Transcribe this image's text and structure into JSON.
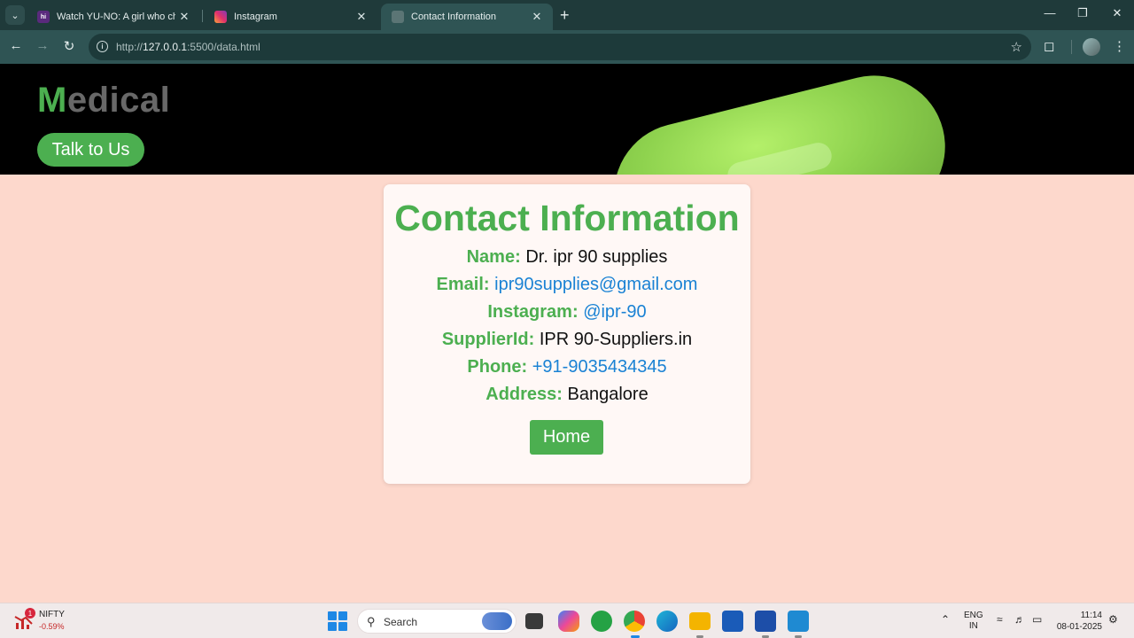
{
  "browser": {
    "tabs": [
      {
        "title": "Watch YU-NO: A girl who chant",
        "favicon": "hi",
        "active": false
      },
      {
        "title": "Instagram",
        "favicon": "",
        "active": false
      },
      {
        "title": "Contact Information",
        "favicon": "",
        "active": true
      }
    ],
    "url": {
      "prefix": "http://",
      "host": "127.0.0.1",
      "rest": ":5500/data.html"
    }
  },
  "page": {
    "logo_first": "M",
    "logo_rest": "edical",
    "talk_button": "Talk to Us",
    "card": {
      "title": "Contact Information",
      "rows": [
        {
          "label": "Name:",
          "value": "Dr. ipr 90 supplies",
          "link": false
        },
        {
          "label": "Email:",
          "value": "ipr90supplies@gmail.com",
          "link": true
        },
        {
          "label": "Instagram:",
          "value": "@ipr-90",
          "link": true
        },
        {
          "label": "SupplierId:",
          "value": "IPR 90-Suppliers.in",
          "link": false
        },
        {
          "label": "Phone:",
          "value": "+91-9035434345",
          "link": true
        },
        {
          "label": "Address:",
          "value": "Bangalore",
          "link": false
        }
      ],
      "home_button": "Home"
    },
    "colors": {
      "accent": "#4caf50",
      "link": "#1a82d4",
      "background": "#fdd8cc"
    }
  },
  "taskbar": {
    "stock": {
      "name": "NIFTY",
      "change": "-0.59%",
      "badge": "1"
    },
    "search_label": "Search",
    "language": {
      "line1": "ENG",
      "line2": "IN"
    },
    "time": "11:14",
    "date": "08-01-2025"
  }
}
